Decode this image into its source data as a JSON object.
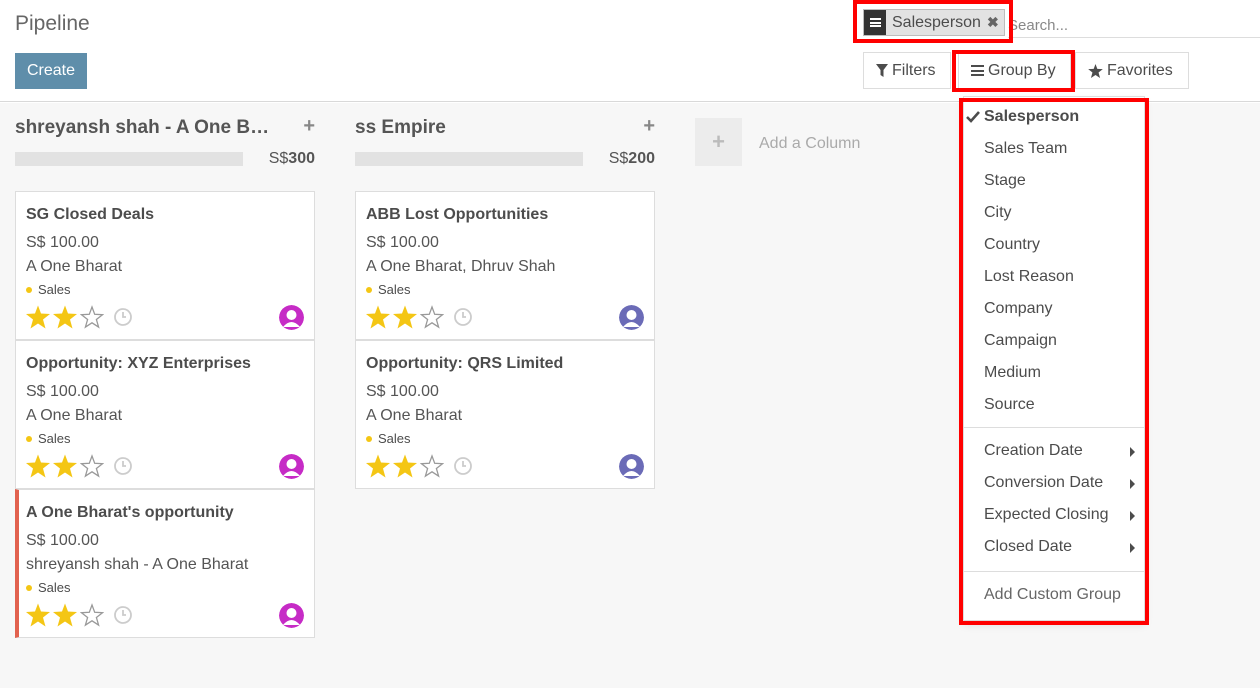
{
  "page": {
    "title": "Pipeline"
  },
  "toolbar": {
    "create_label": "Create",
    "filters_label": "Filters",
    "groupby_label": "Group By",
    "favorites_label": "Favorites"
  },
  "search": {
    "facet_label": "Salesperson",
    "placeholder": "Search..."
  },
  "columns": [
    {
      "title": "shreyansh shah - A One Bh…",
      "total_currency": "S$",
      "total_value": "300",
      "cards": [
        {
          "title": "SG Closed Deals",
          "amount": "S$ 100.00",
          "partner": "A One Bharat",
          "tag": "Sales",
          "stars": 2,
          "avatar_color": "#c62bc6"
        },
        {
          "title": "Opportunity: XYZ Enterprises",
          "amount": "S$ 100.00",
          "partner": "A One Bharat",
          "tag": "Sales",
          "stars": 2,
          "avatar_color": "#c62bc6"
        },
        {
          "title": "A One Bharat's opportunity",
          "amount": "S$ 100.00",
          "partner": "shreyansh shah - A One Bharat",
          "tag": "Sales",
          "stars": 2,
          "avatar_color": "#c62bc6"
        }
      ]
    },
    {
      "title": "ss Empire",
      "total_currency": "S$",
      "total_value": "200",
      "cards": [
        {
          "title": "ABB Lost Opportunities",
          "amount": "S$ 100.00",
          "partner": "A One Bharat, Dhruv Shah",
          "tag": "Sales",
          "stars": 2,
          "avatar_color": "#6b6bb7"
        },
        {
          "title": "Opportunity: QRS Limited",
          "amount": "S$ 100.00",
          "partner": "A One Bharat",
          "tag": "Sales",
          "stars": 2,
          "avatar_color": "#6b6bb7"
        }
      ]
    }
  ],
  "add_column_label": "Add a Column",
  "groupby_menu": {
    "options": [
      "Salesperson",
      "Sales Team",
      "Stage",
      "City",
      "Country",
      "Lost Reason",
      "Company",
      "Campaign",
      "Medium",
      "Source"
    ],
    "selected": "Salesperson",
    "date_options": [
      "Creation Date",
      "Conversion Date",
      "Expected Closing",
      "Closed Date"
    ],
    "custom_label": "Add Custom Group"
  },
  "colors": {
    "accent": "#5f8eaa",
    "highlight": "#ff0000",
    "star": "#f4c614",
    "flag": "#e2624f"
  }
}
